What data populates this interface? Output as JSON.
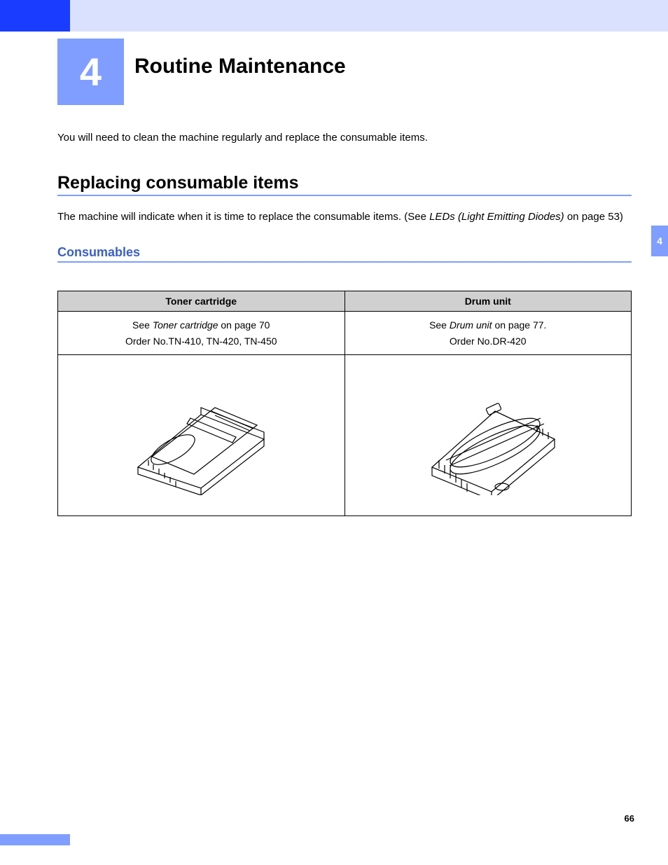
{
  "header": {
    "chapter_number": "4",
    "chapter_title": "Routine Maintenance"
  },
  "intro": "You will need to clean the machine regularly and replace the consumable items.",
  "section1": {
    "heading": "Replacing consumable items",
    "text_part1": "The machine will indicate when it is time to replace the consumable items. (See ",
    "text_italic": "LEDs (Light Emitting Diodes)",
    "text_part2": " on page 53)"
  },
  "subsection": {
    "heading": "Consumables"
  },
  "table": {
    "col1_header": "Toner cartridge",
    "col2_header": "Drum unit",
    "col1_see_prefix": "See ",
    "col1_see_italic": "Toner cartridge",
    "col1_see_suffix": " on page 70",
    "col1_order": "Order No.TN-410, TN-420, TN-450",
    "col2_see_prefix": "See ",
    "col2_see_italic": "Drum unit",
    "col2_see_suffix": " on page 77.",
    "col2_order": "Order No.DR-420"
  },
  "side_tab": "4",
  "page_number": "66"
}
